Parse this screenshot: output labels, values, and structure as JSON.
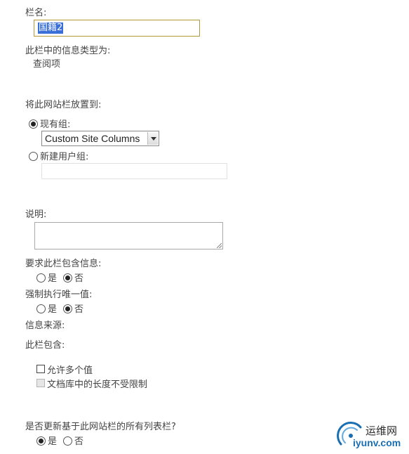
{
  "column_name": {
    "label": "栏名:",
    "value": "国籍2"
  },
  "info_type": {
    "label": "此栏中的信息类型为:",
    "value": "查阅项"
  },
  "placement": {
    "label": "将此网站栏放置到:",
    "existing_group_label": "现有组:",
    "existing_group_selected": true,
    "existing_group_value": "Custom Site Columns",
    "new_group_label": "新建用户组:",
    "new_group_selected": false
  },
  "description": {
    "label": "说明:"
  },
  "require_info": {
    "label": "要求此栏包含信息:",
    "yes_label": "是",
    "no_label": "否",
    "selected": "no"
  },
  "enforce_unique": {
    "label": "强制执行唯一值:",
    "yes_label": "是",
    "no_label": "否",
    "selected": "no"
  },
  "info_source": {
    "label": "信息来源:"
  },
  "column_contains": {
    "label": "此栏包含:",
    "allow_multiple_label": "允许多个值",
    "allow_multiple_checked": false,
    "unlimited_length_label": "文档库中的长度不受限制",
    "unlimited_length_checked": false,
    "unlimited_length_disabled": true
  },
  "update_lists": {
    "label": "是否更新基于此网站栏的所有列表栏?",
    "yes_label": "是",
    "no_label": "否",
    "selected": "yes"
  },
  "watermark": {
    "title": "运维网",
    "url": "iyunv.com",
    "accent_color": "#1a6fb3"
  }
}
